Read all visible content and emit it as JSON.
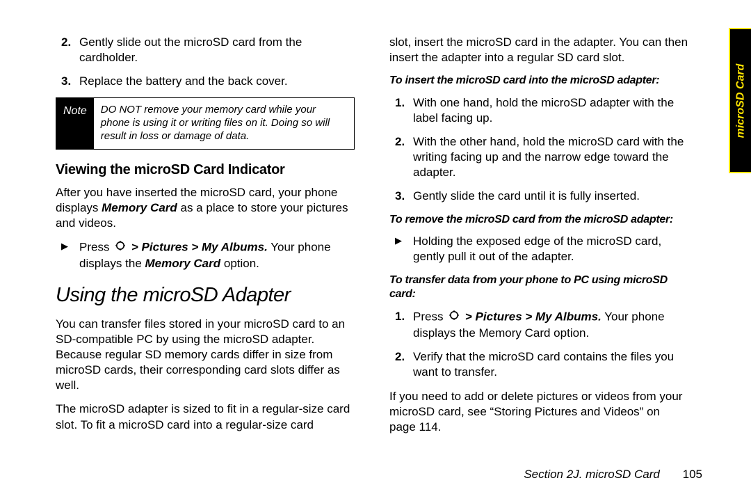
{
  "sidetab": {
    "label": "microSD Card"
  },
  "left": {
    "step2": "Gently slide out the microSD card from the cardholder.",
    "step3": "Replace the battery and the back cover.",
    "note_label": "Note",
    "note_body": "DO NOT remove your memory card while your phone is using it or writing files on it. Doing so will result in loss or damage of data.",
    "viewing_head": "Viewing the microSD Card Indicator",
    "viewing_p1a": "After you have inserted the microSD card, your phone displays ",
    "viewing_p1b": "Memory Card",
    "viewing_p1c": " as a place to store your pictures and videos.",
    "viewing_b1a": "Press ",
    "viewing_b1b": " > Pictures > My Albums.",
    "viewing_b1c": " Your phone displays the ",
    "viewing_b1d": "Memory Card",
    "viewing_b1e": " option.",
    "using_head": "Using the microSD Adapter",
    "using_p1": "You can transfer files stored in your microSD card to an SD-compatible PC by using the microSD adapter. Because regular SD memory cards differ in size from microSD cards, their corresponding card slots differ as well.",
    "using_p2": "The microSD adapter is sized to fit in a regular-size card slot. To fit a microSD card into a regular-size card"
  },
  "right": {
    "cont": "slot, insert the microSD card in the adapter. You can then insert the adapter into a regular SD card slot.",
    "insert_head": "To insert the microSD card into the microSD adapter:",
    "ins1": "With one hand, hold the microSD adapter with the label facing up.",
    "ins2": "With the other hand, hold the microSD card with the writing facing up and the narrow edge toward the adapter.",
    "ins3": "Gently slide the card until it is fully inserted.",
    "remove_head": "To remove the microSD card from the microSD adapter:",
    "rem1": "Holding the exposed edge of the microSD card, gently pull it out of the adapter.",
    "transfer_head": "To transfer data from your phone to PC using microSD card:",
    "tr1a": "Press ",
    "tr1b": " > Pictures > My Albums.",
    "tr1c": " Your phone displays the Memory Card option.",
    "tr2": "Verify that the microSD card contains the files you want to transfer.",
    "closing": "If you need to add or delete pictures or videos from your microSD card, see “Storing Pictures and Videos” on page 114."
  },
  "footer": {
    "section": "Section 2J. microSD Card",
    "page": "105"
  }
}
